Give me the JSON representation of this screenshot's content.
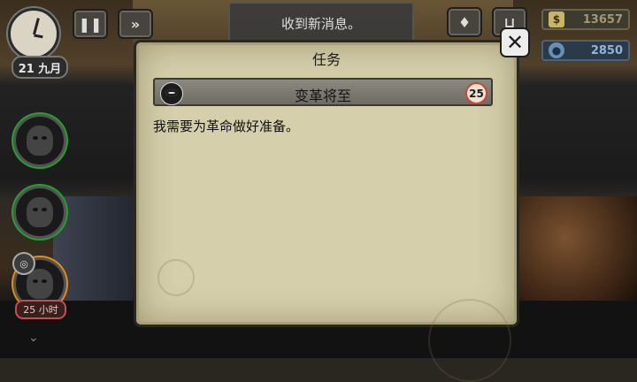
{
  "hud": {
    "date": "21 九月",
    "money": "13657",
    "coins": "2850",
    "timer": "25 小时",
    "icons": {
      "clock": "clock-icon",
      "pause": "pause-icon",
      "fast_forward": "fast-forward-icon",
      "inventory": "bag-icon",
      "shop": "cart-icon",
      "money": "money-icon",
      "coin": "coin-icon"
    }
  },
  "notification": {
    "text": "收到新消息。"
  },
  "dialog": {
    "title": "任务",
    "mission": {
      "name": "变革将至",
      "level": "25",
      "description": "我需要为革命做好准备。"
    }
  },
  "colors": {
    "panel": "#d5cfab",
    "avatar_ring_active": "#25a02f",
    "avatar_ring_busy": "#e38b1c",
    "badge_border": "#c34a3a"
  }
}
